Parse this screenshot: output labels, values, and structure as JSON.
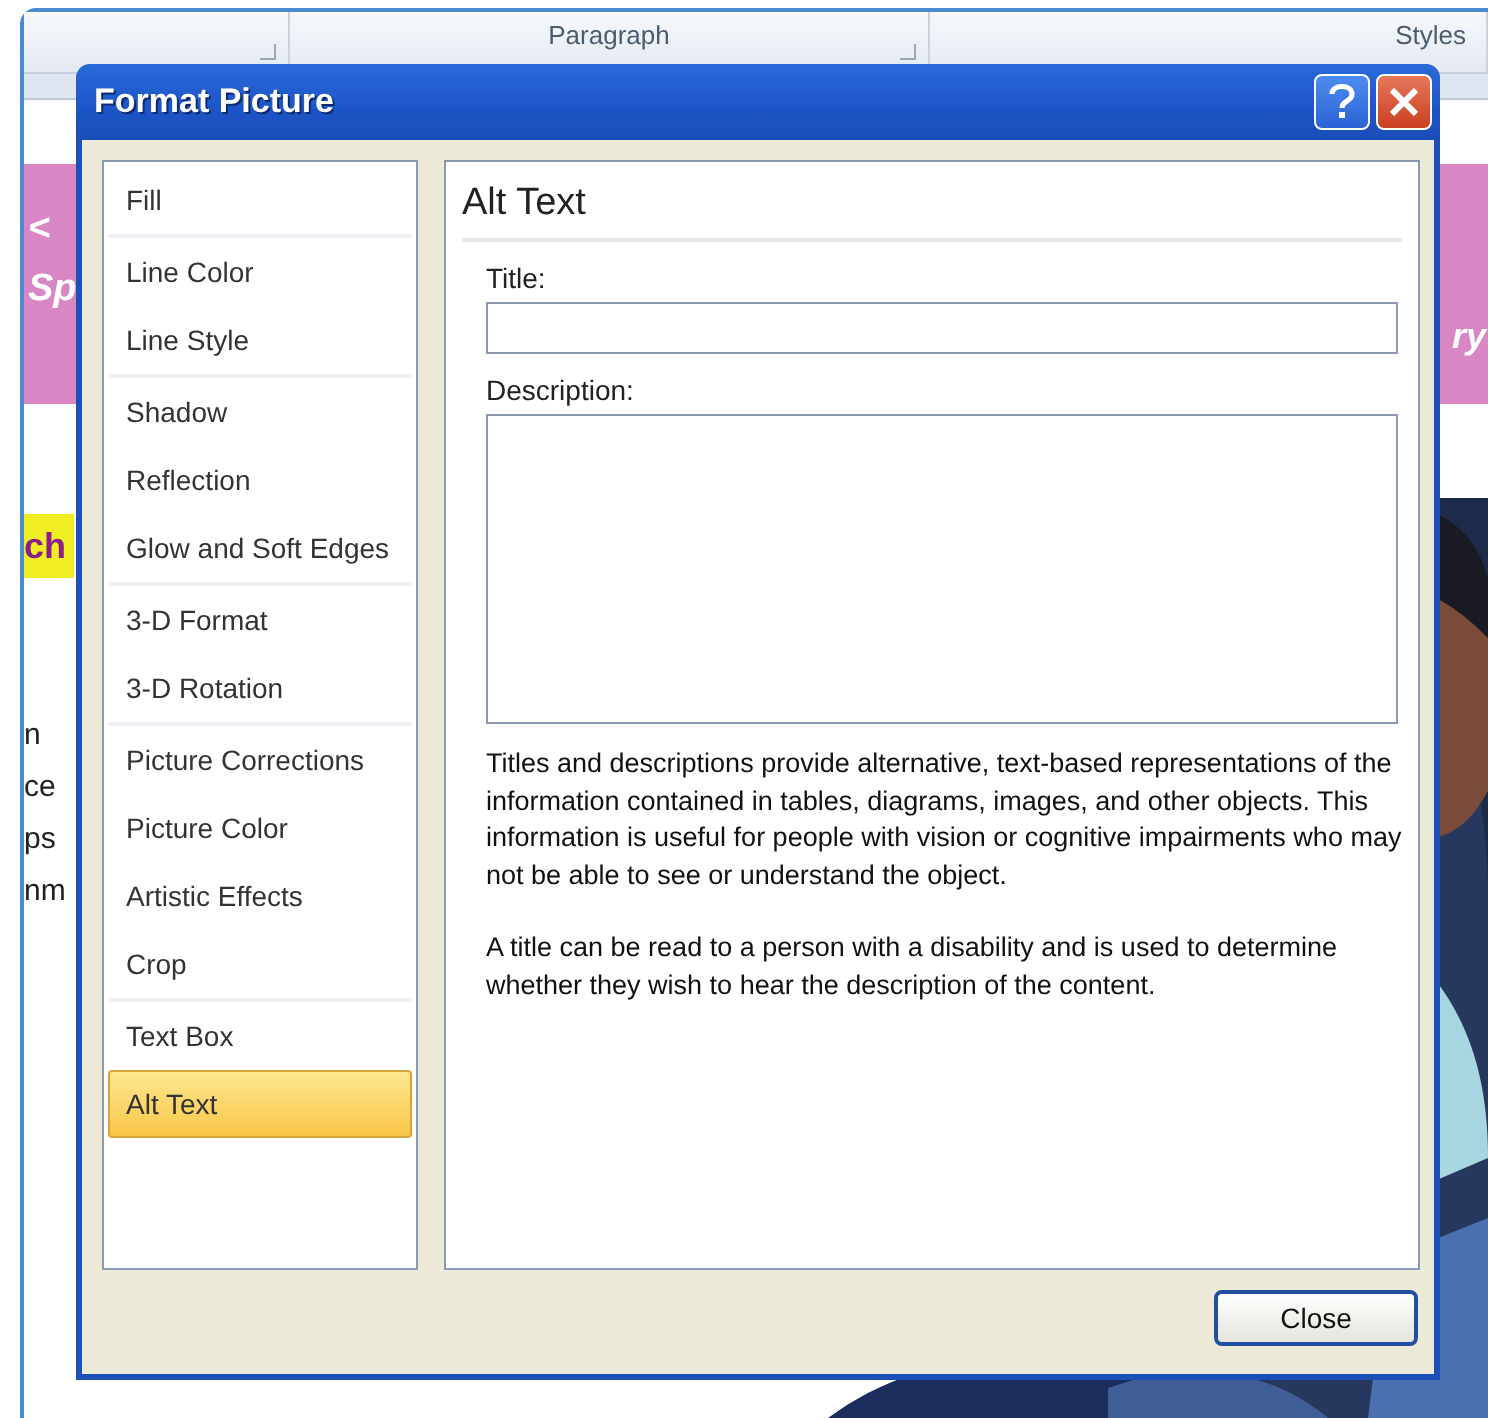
{
  "document": {
    "ribbon_groups": [
      "Paragraph",
      "Styles"
    ],
    "banner_left": [
      "<",
      "Sp"
    ],
    "banner_right": "ry",
    "highlight": "ch",
    "body_fragments": [
      "n",
      "ce",
      "ps",
      "nm"
    ]
  },
  "dialog": {
    "title": "Format Picture",
    "sidebar": [
      {
        "items": [
          {
            "label": "Fill",
            "selected": false
          }
        ]
      },
      {
        "items": [
          {
            "label": "Line Color",
            "selected": false
          },
          {
            "label": "Line Style",
            "selected": false
          }
        ]
      },
      {
        "items": [
          {
            "label": "Shadow",
            "selected": false
          },
          {
            "label": "Reflection",
            "selected": false
          },
          {
            "label": "Glow and Soft Edges",
            "selected": false
          }
        ]
      },
      {
        "items": [
          {
            "label": "3-D Format",
            "selected": false
          },
          {
            "label": "3-D Rotation",
            "selected": false
          }
        ]
      },
      {
        "items": [
          {
            "label": "Picture Corrections",
            "selected": false
          },
          {
            "label": "Picture Color",
            "selected": false
          },
          {
            "label": "Artistic Effects",
            "selected": false
          },
          {
            "label": "Crop",
            "selected": false
          }
        ]
      },
      {
        "items": [
          {
            "label": "Text Box",
            "selected": false
          },
          {
            "label": "Alt Text",
            "selected": true
          }
        ]
      }
    ],
    "panel": {
      "heading": "Alt Text",
      "title_label": "Title:",
      "description_label": "Description:",
      "paragraphs": [
        "Titles and descriptions provide alternative, text-based representations of the information contained in tables, diagrams, images, and other objects. This information is useful for people with vision or cognitive impairments who may not be able to see or understand the object.",
        "A title can be read to a person with a disability and is used to determine whether they wish to hear the description of the content."
      ]
    },
    "buttons": [
      "Close"
    ]
  }
}
